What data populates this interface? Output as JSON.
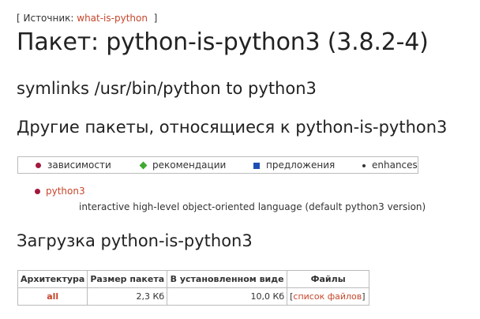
{
  "source": {
    "prefix": "[ Источник: ",
    "link": "what-is-python",
    "suffix": "]"
  },
  "title": "Пакет: python-is-python3 (3.8.2-4)",
  "short_description": "symlinks /usr/bin/python to python3",
  "related": {
    "heading": "Другие пакеты, относящиеся к python-is-python3",
    "legend": {
      "depends": "зависимости",
      "recommends": "рекомендации",
      "suggests": "предложения",
      "enhances": "enhances"
    },
    "packages": [
      {
        "name": "python3",
        "description": "interactive high-level object-oriented language (default python3 version)"
      }
    ]
  },
  "download": {
    "heading": "Загрузка python-is-python3",
    "headers": [
      "Архитектура",
      "Размер пакета",
      "В установленном виде",
      "Файлы"
    ],
    "rows": [
      {
        "arch": "all",
        "size": "2,3 Кб",
        "installed": "10,0 Кб",
        "files_open": "[",
        "files_link": "список файлов",
        "files_close": "]"
      }
    ]
  },
  "colors": {
    "link": "#c7462b",
    "depends": "#a2193d",
    "recommends": "#3faa2f",
    "suggests": "#1e4fb5"
  },
  "icons": {
    "depends": "red-dot-icon",
    "recommends": "green-diamond-icon",
    "suggests": "blue-square-icon",
    "enhances": "black-dot-icon"
  }
}
